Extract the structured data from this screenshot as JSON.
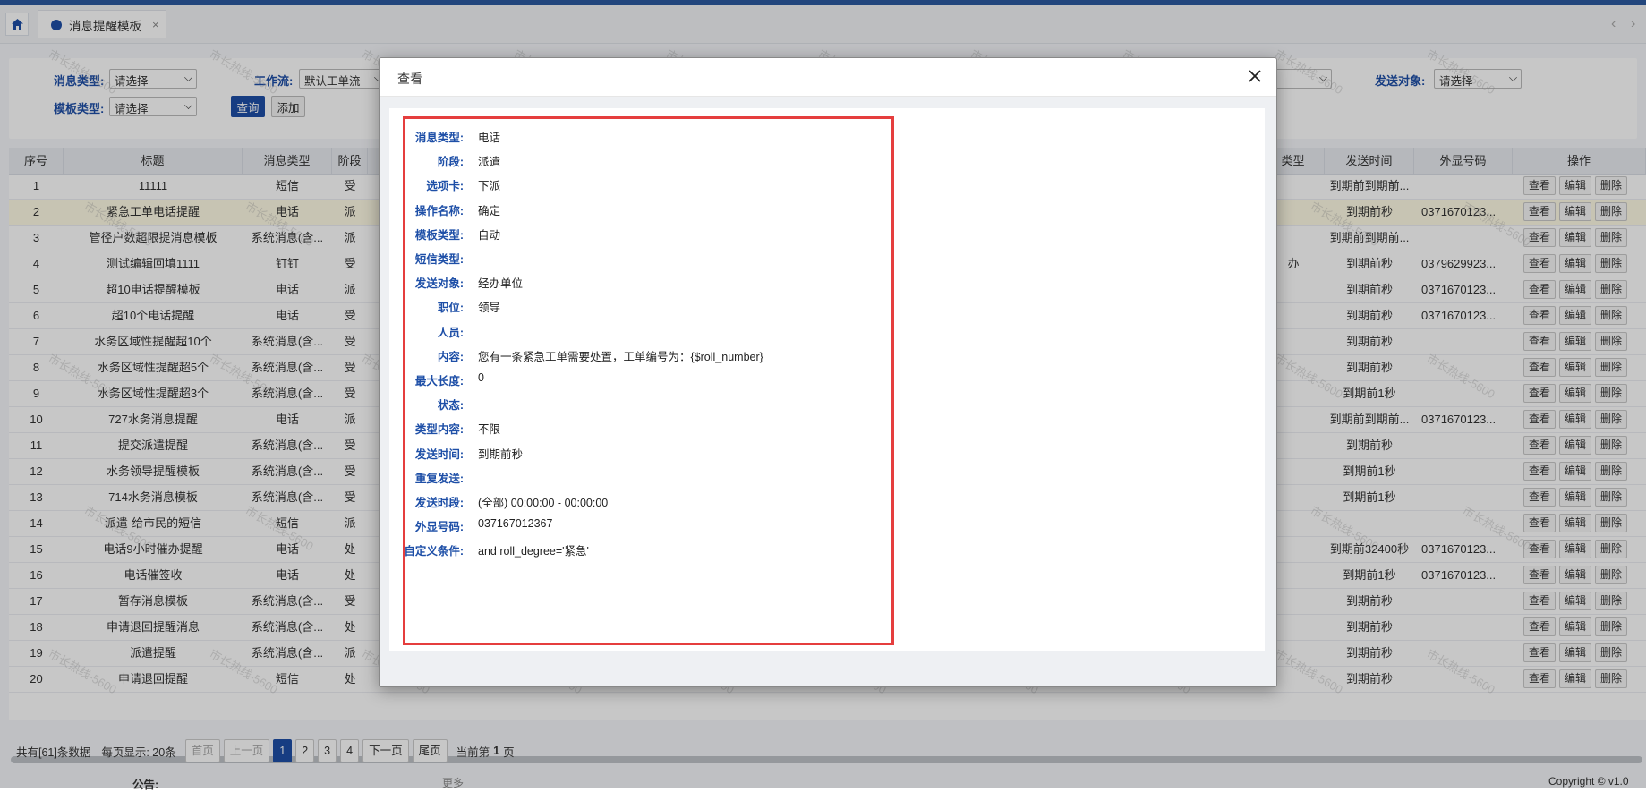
{
  "tabbar": {
    "tab_label": "消息提醒模板",
    "tab_close": "×",
    "nav_prev": "‹",
    "nav_next": "›"
  },
  "filter": {
    "msg_type_label": "消息类型:",
    "msg_type_value": "请选择",
    "workflow_label": "工作流:",
    "workflow_value": "默认工单流",
    "send_target_label": "发送对象:",
    "send_target_value": "请选择",
    "template_type_label": "模板类型:",
    "template_type_value": "请选择",
    "query_btn": "查询",
    "add_btn": "添加"
  },
  "grid": {
    "headers": {
      "seq": "序号",
      "title": "标题",
      "msg_type": "消息类型",
      "stage": "阶段",
      "type": "类型",
      "send_time": "发送时间",
      "display_no": "外显号码",
      "ops": "操作"
    },
    "op_view": "查看",
    "op_edit": "编辑",
    "op_delete": "删除",
    "rows": [
      {
        "seq": "1",
        "title": "11111",
        "msg_type": "短信",
        "stage": "受",
        "type": "",
        "send_time": "到期前到期前...",
        "display_no": ""
      },
      {
        "seq": "2",
        "title": "紧急工单电话提醒",
        "msg_type": "电话",
        "stage": "派",
        "type": "",
        "send_time": "到期前秒",
        "display_no": "0371670123..."
      },
      {
        "seq": "3",
        "title": "管径户数超限提消息模板",
        "msg_type": "系统消息(含...",
        "stage": "派",
        "type": "",
        "send_time": "到期前到期前...",
        "display_no": ""
      },
      {
        "seq": "4",
        "title": "测试编辑回填1111",
        "msg_type": "钉钉",
        "stage": "受",
        "type": "办",
        "send_time": "到期前秒",
        "display_no": "0379629923..."
      },
      {
        "seq": "5",
        "title": "超10电话提醒模板",
        "msg_type": "电话",
        "stage": "派",
        "type": "",
        "send_time": "到期前秒",
        "display_no": "0371670123..."
      },
      {
        "seq": "6",
        "title": "超10个电话提醒",
        "msg_type": "电话",
        "stage": "受",
        "type": "",
        "send_time": "到期前秒",
        "display_no": "0371670123..."
      },
      {
        "seq": "7",
        "title": "水务区域性提醒超10个",
        "msg_type": "系统消息(含...",
        "stage": "受",
        "type": "",
        "send_time": "到期前秒",
        "display_no": ""
      },
      {
        "seq": "8",
        "title": "水务区域性提醒超5个",
        "msg_type": "系统消息(含...",
        "stage": "受",
        "type": "",
        "send_time": "到期前秒",
        "display_no": ""
      },
      {
        "seq": "9",
        "title": "水务区域性提醒超3个",
        "msg_type": "系统消息(含...",
        "stage": "受",
        "type": "",
        "send_time": "到期前1秒",
        "display_no": ""
      },
      {
        "seq": "10",
        "title": "727水务消息提醒",
        "msg_type": "电话",
        "stage": "派",
        "type": "",
        "send_time": "到期前到期前...",
        "display_no": "0371670123..."
      },
      {
        "seq": "11",
        "title": "提交派遣提醒",
        "msg_type": "系统消息(含...",
        "stage": "受",
        "type": "",
        "send_time": "到期前秒",
        "display_no": ""
      },
      {
        "seq": "12",
        "title": "水务领导提醒模板",
        "msg_type": "系统消息(含...",
        "stage": "受",
        "type": "",
        "send_time": "到期前1秒",
        "display_no": ""
      },
      {
        "seq": "13",
        "title": "714水务消息模板",
        "msg_type": "系统消息(含...",
        "stage": "受",
        "type": "",
        "send_time": "到期前1秒",
        "display_no": ""
      },
      {
        "seq": "14",
        "title": "派遣-给市民的短信",
        "msg_type": "短信",
        "stage": "派",
        "type": "",
        "send_time": "",
        "display_no": ""
      },
      {
        "seq": "15",
        "title": "电话9小时催办提醒",
        "msg_type": "电话",
        "stage": "处",
        "type": "",
        "send_time": "到期前32400秒",
        "display_no": "0371670123..."
      },
      {
        "seq": "16",
        "title": "电话催签收",
        "msg_type": "电话",
        "stage": "处",
        "type": "",
        "send_time": "到期前1秒",
        "display_no": "0371670123..."
      },
      {
        "seq": "17",
        "title": "暂存消息模板",
        "msg_type": "系统消息(含...",
        "stage": "受",
        "type": "",
        "send_time": "到期前秒",
        "display_no": ""
      },
      {
        "seq": "18",
        "title": "申请退回提醒消息",
        "msg_type": "系统消息(含...",
        "stage": "处",
        "type": "",
        "send_time": "到期前秒",
        "display_no": ""
      },
      {
        "seq": "19",
        "title": "派遣提醒",
        "msg_type": "系统消息(含...",
        "stage": "派",
        "type": "",
        "send_time": "到期前秒",
        "display_no": ""
      },
      {
        "seq": "20",
        "title": "申请退回提醒",
        "msg_type": "短信",
        "stage": "处",
        "type": "",
        "send_time": "到期前秒",
        "display_no": ""
      }
    ]
  },
  "pager": {
    "total_text": "共有[61]条数据",
    "per_page_text": "每页显示: 20条",
    "first": "首页",
    "prev": "上一页",
    "pages": [
      "1",
      "2",
      "3",
      "4"
    ],
    "next": "下一页",
    "last": "尾页",
    "current_prefix": "当前第",
    "current_page": "1",
    "current_suffix": "页"
  },
  "footer": {
    "notice": "公告:",
    "more": "更多",
    "copyright": "Copyright © v1.0"
  },
  "watermark": "市长热线-5600",
  "modal": {
    "title": "查看",
    "fields": [
      {
        "label": "消息类型:",
        "value": "电话"
      },
      {
        "label": "阶段:",
        "value": "派遣"
      },
      {
        "label": "选项卡:",
        "value": "下派"
      },
      {
        "label": "操作名称:",
        "value": "确定"
      },
      {
        "label": "模板类型:",
        "value": "自动"
      },
      {
        "label": "短信类型:",
        "value": ""
      },
      {
        "label": "发送对象:",
        "value": "经办单位"
      },
      {
        "label": "职位:",
        "value": "领导"
      },
      {
        "label": "人员:",
        "value": ""
      },
      {
        "label": "内容:",
        "value": "您有一条紧急工单需要处置，工单编号为：{$roll_number}"
      },
      {
        "label": "最大长度:",
        "value": "0"
      },
      {
        "label": "状态:",
        "value": ""
      },
      {
        "label": "类型内容:",
        "value": "不限"
      },
      {
        "label": "发送时间:",
        "value": "到期前秒"
      },
      {
        "label": "重复发送:",
        "value": ""
      },
      {
        "label": "发送时段:",
        "value": "(全部) 00:00:00 - 00:00:00"
      },
      {
        "label": "外显号码:",
        "value": "037167012367"
      },
      {
        "label": "自定义条件:",
        "value": "and roll_degree='紧急'"
      }
    ]
  }
}
